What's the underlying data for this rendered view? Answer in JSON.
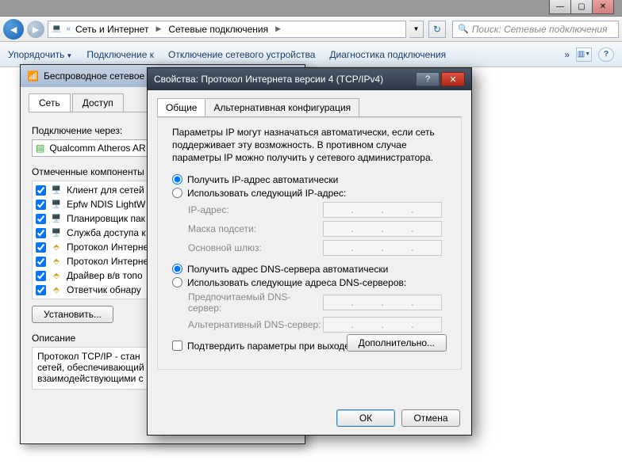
{
  "win_controls": {
    "min": "—",
    "max": "▢",
    "close": "✕"
  },
  "nav": {
    "crumb_sep": "«",
    "crumb1": "Сеть и Интернет",
    "crumb2": "Сетевые подключения"
  },
  "search": {
    "placeholder": "Поиск: Сетевые подключения"
  },
  "toolbar": {
    "organize": "Упорядочить",
    "connect": "Подключение к",
    "disable": "Отключение сетевого устройства",
    "diagnose": "Диагностика подключения"
  },
  "dialog1": {
    "title": "Беспроводное сетевое с",
    "tabs": {
      "network": "Сеть",
      "access": "Доступ"
    },
    "connect_via": "Подключение через:",
    "adapter": "Qualcomm Atheros AR",
    "components_lbl": "Отмеченные компоненты и",
    "items": [
      "Клиент для сетей",
      "Epfw NDIS LightW",
      "Планировщик пак",
      "Служба доступа к",
      "Протокол Интерне",
      "Протокол Интерне",
      "Драйвер в/в топо",
      "Ответчик обнару"
    ],
    "btn_install": "Установить...",
    "desc_lbl": "Описание",
    "desc_text": "Протокол TCP/IP - стан\nсетей, обеспечивающий\nвзаимодействующими с"
  },
  "dialog2": {
    "title": "Свойства: Протокол Интернета версии 4 (TCP/IPv4)",
    "help_btn": "?",
    "close_btn": "✕",
    "tabs": {
      "general": "Общие",
      "alt": "Альтернативная конфигурация"
    },
    "help": "Параметры IP могут назначаться автоматически, если сеть поддерживает эту возможность. В противном случае параметры IP можно получить у сетевого администратора.",
    "ip_auto": "Получить IP-адрес автоматически",
    "ip_manual": "Использовать следующий IP-адрес:",
    "ip_label": "IP-адрес:",
    "mask_label": "Маска подсети:",
    "gw_label": "Основной шлюз:",
    "dns_auto": "Получить адрес DNS-сервера автоматически",
    "dns_manual": "Использовать следующие адреса DNS-серверов:",
    "dns1_label": "Предпочитаемый DNS-сервер:",
    "dns2_label": "Альтернативный DNS-сервер:",
    "validate": "Подтвердить параметры при выходе",
    "advanced": "Дополнительно...",
    "ok": "ОК",
    "cancel": "Отмена"
  }
}
